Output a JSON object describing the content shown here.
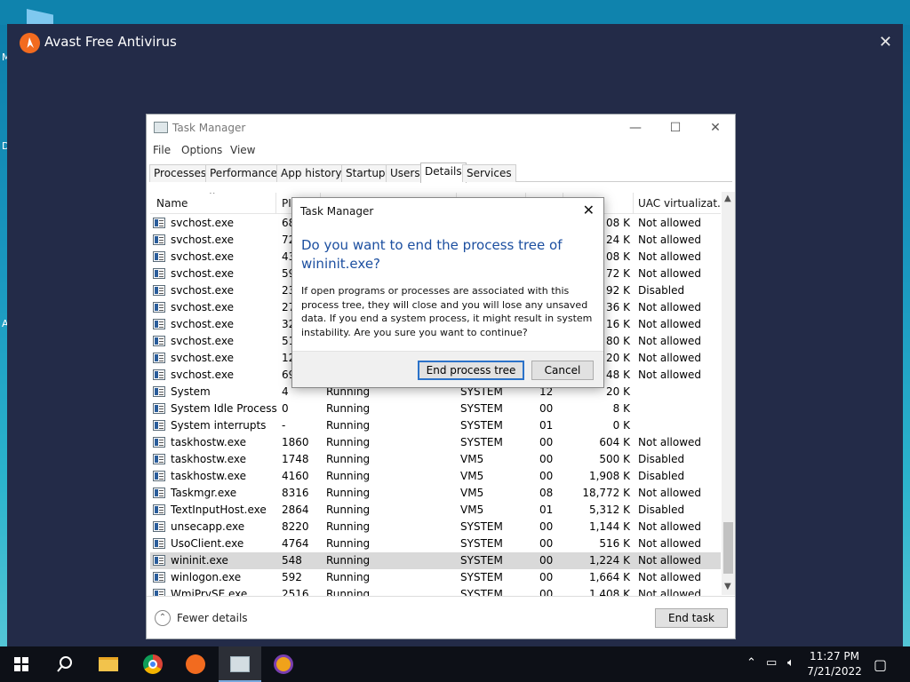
{
  "desktop": {
    "left_letters": [
      "M",
      "D",
      "A"
    ]
  },
  "avast": {
    "title": "Avast Free Antivirus",
    "close_glyph": "✕"
  },
  "taskmanager": {
    "title": "Task Manager",
    "controls": {
      "min": "—",
      "max": "☐",
      "close": "✕"
    },
    "menu": [
      "File",
      "Options",
      "View"
    ],
    "tabs": [
      "Processes",
      "Performance",
      "App history",
      "Startup",
      "Users",
      "Details",
      "Services"
    ],
    "active_tab": "Details",
    "columns": {
      "name": "Name",
      "pid": "PI",
      "uac": "UAC virtualizat..."
    },
    "rows": [
      {
        "name": "svchost.exe",
        "pid": "68",
        "status": "",
        "user": "",
        "cpu": "",
        "mem": "08 K",
        "uac": "Not allowed"
      },
      {
        "name": "svchost.exe",
        "pid": "72",
        "status": "",
        "user": "",
        "cpu": "",
        "mem": "24 K",
        "uac": "Not allowed"
      },
      {
        "name": "svchost.exe",
        "pid": "43",
        "status": "",
        "user": "",
        "cpu": "",
        "mem": "08 K",
        "uac": "Not allowed"
      },
      {
        "name": "svchost.exe",
        "pid": "59",
        "status": "",
        "user": "",
        "cpu": "",
        "mem": "72 K",
        "uac": "Not allowed"
      },
      {
        "name": "svchost.exe",
        "pid": "23",
        "status": "",
        "user": "",
        "cpu": "",
        "mem": "92 K",
        "uac": "Disabled"
      },
      {
        "name": "svchost.exe",
        "pid": "27",
        "status": "",
        "user": "",
        "cpu": "",
        "mem": "36 K",
        "uac": "Not allowed"
      },
      {
        "name": "svchost.exe",
        "pid": "32",
        "status": "",
        "user": "",
        "cpu": "",
        "mem": "16 K",
        "uac": "Not allowed"
      },
      {
        "name": "svchost.exe",
        "pid": "51",
        "status": "",
        "user": "",
        "cpu": "",
        "mem": "80 K",
        "uac": "Not allowed"
      },
      {
        "name": "svchost.exe",
        "pid": "12",
        "status": "",
        "user": "",
        "cpu": "",
        "mem": "20 K",
        "uac": "Not allowed"
      },
      {
        "name": "svchost.exe",
        "pid": "69",
        "status": "",
        "user": "",
        "cpu": "",
        "mem": "48 K",
        "uac": "Not allowed"
      },
      {
        "name": "System",
        "pid": "4",
        "status": "Running",
        "user": "SYSTEM",
        "cpu": "12",
        "mem": "20 K",
        "uac": ""
      },
      {
        "name": "System Idle Process",
        "pid": "0",
        "status": "Running",
        "user": "SYSTEM",
        "cpu": "00",
        "mem": "8 K",
        "uac": ""
      },
      {
        "name": "System interrupts",
        "pid": "-",
        "status": "Running",
        "user": "SYSTEM",
        "cpu": "01",
        "mem": "0 K",
        "uac": ""
      },
      {
        "name": "taskhostw.exe",
        "pid": "1860",
        "status": "Running",
        "user": "SYSTEM",
        "cpu": "00",
        "mem": "604 K",
        "uac": "Not allowed"
      },
      {
        "name": "taskhostw.exe",
        "pid": "1748",
        "status": "Running",
        "user": "VM5",
        "cpu": "00",
        "mem": "500 K",
        "uac": "Disabled"
      },
      {
        "name": "taskhostw.exe",
        "pid": "4160",
        "status": "Running",
        "user": "VM5",
        "cpu": "00",
        "mem": "1,908 K",
        "uac": "Disabled"
      },
      {
        "name": "Taskmgr.exe",
        "pid": "8316",
        "status": "Running",
        "user": "VM5",
        "cpu": "08",
        "mem": "18,772 K",
        "uac": "Not allowed"
      },
      {
        "name": "TextInputHost.exe",
        "pid": "2864",
        "status": "Running",
        "user": "VM5",
        "cpu": "01",
        "mem": "5,312 K",
        "uac": "Disabled"
      },
      {
        "name": "unsecapp.exe",
        "pid": "8220",
        "status": "Running",
        "user": "SYSTEM",
        "cpu": "00",
        "mem": "1,144 K",
        "uac": "Not allowed"
      },
      {
        "name": "UsoClient.exe",
        "pid": "4764",
        "status": "Running",
        "user": "SYSTEM",
        "cpu": "00",
        "mem": "516 K",
        "uac": "Not allowed"
      },
      {
        "name": "wininit.exe",
        "pid": "548",
        "status": "Running",
        "user": "SYSTEM",
        "cpu": "00",
        "mem": "1,224 K",
        "uac": "Not allowed",
        "selected": true
      },
      {
        "name": "winlogon.exe",
        "pid": "592",
        "status": "Running",
        "user": "SYSTEM",
        "cpu": "00",
        "mem": "1,664 K",
        "uac": "Not allowed"
      },
      {
        "name": "WmiPrvSE.exe",
        "pid": "2516",
        "status": "Running",
        "user": "SYSTEM",
        "cpu": "00",
        "mem": "1,408 K",
        "uac": "Not allowed"
      }
    ],
    "fewer_details": "Fewer details",
    "end_task": "End task"
  },
  "dialog": {
    "title": "Task Manager",
    "question": "Do you want to end the process tree of wininit.exe?",
    "body": "If open programs or processes are associated with this process tree, they will close and you will lose any unsaved data. If you end a system process, it might result in system instability. Are you sure you want to continue?",
    "primary_button": "End process tree",
    "cancel_button": "Cancel"
  },
  "taskbar": {
    "time": "11:27 PM",
    "date": "7/21/2022",
    "icons": [
      "windows-start-icon",
      "search-icon",
      "file-explorer-icon",
      "chrome-icon",
      "avast-icon",
      "task-manager-icon",
      "vpn-shield-icon"
    ]
  },
  "colors": {
    "avast_bg": "#232b48",
    "dialog_heading": "#1c4fa0",
    "primary_button_border": "#2b72c9"
  }
}
